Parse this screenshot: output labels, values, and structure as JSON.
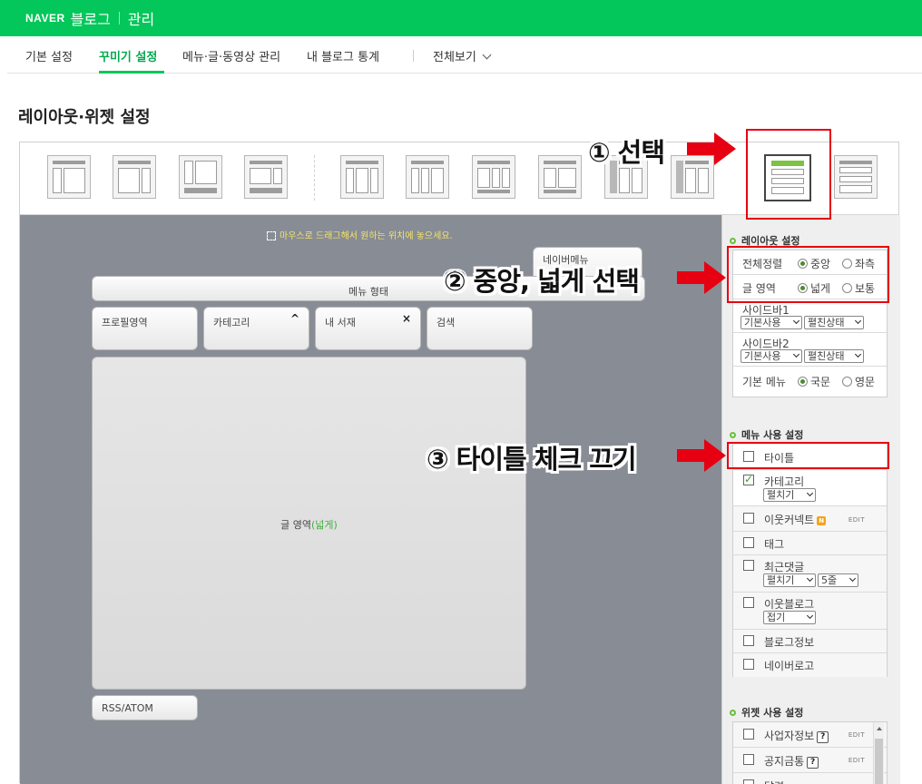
{
  "topbar": {
    "logo": "NAVER",
    "blog": "블로그",
    "manage": "관리"
  },
  "tabs": [
    {
      "label": "기본 설정"
    },
    {
      "label": "꾸미기 설정"
    },
    {
      "label": "메뉴·글·동영상 관리"
    },
    {
      "label": "내 블로그 통계"
    },
    {
      "label": "전체보기"
    }
  ],
  "page_title": "레이아웃·위젯 설정",
  "canvas": {
    "hint": "마우스로 드래그해서 원하는 위치에 놓으세요.",
    "nav_menu": "네이버메뉴",
    "menu_bar": "메뉴 형태",
    "profile": "프로필영역",
    "category": "카테고리",
    "category_ctl": "^",
    "my_books": "내 서재",
    "my_books_ctl": "×",
    "search": "검색",
    "content_label": "글 영역",
    "content_mode": "(넓게)",
    "rss": "RSS/ATOM"
  },
  "layout_settings": {
    "title": "레이아웃 설정",
    "align_label": "전체정렬",
    "align_center": "중앙",
    "align_left": "좌측",
    "area_label": "글 영역",
    "area_wide": "넓게",
    "area_normal": "보통",
    "sidebar1_label": "사이드바1",
    "sidebar2_label": "사이드바2",
    "sidebar_use": "기본사용",
    "sidebar_state": "펼친상태",
    "base_menu_label": "기본 메뉴",
    "lang_kr": "국문",
    "lang_en": "영문"
  },
  "menu_settings": {
    "title": "메뉴 사용 설정",
    "items": [
      {
        "label": "타이틀",
        "checked": false
      },
      {
        "label": "카테고리",
        "checked": true,
        "select": "펼치기"
      },
      {
        "label": "이웃커넥트",
        "checked": false,
        "badge": "N",
        "edit": "EDIT"
      },
      {
        "label": "태그",
        "checked": false
      },
      {
        "label": "최근댓글",
        "checked": false,
        "select": "펼치기",
        "select2": "5줄"
      },
      {
        "label": "이웃블로그",
        "checked": false,
        "select": "접기"
      },
      {
        "label": "블로그정보",
        "checked": false
      },
      {
        "label": "네이버로고",
        "checked": false
      }
    ]
  },
  "widget_settings": {
    "title": "위젯 사용 설정",
    "items": [
      {
        "label": "사업자정보",
        "badge": "?",
        "edit": "EDIT"
      },
      {
        "label": "공지금통",
        "badge": "?",
        "edit": "EDIT"
      },
      {
        "label": "달력"
      }
    ]
  },
  "annotations": {
    "step1": "① 선택",
    "step2": "② 중앙, 넓게 선택",
    "step3": "③ 타이틀 체크 끄기"
  },
  "colors": {
    "brand": "#03c75a",
    "annotation_red": "#e60012",
    "canvas_bg": "#888c95"
  }
}
